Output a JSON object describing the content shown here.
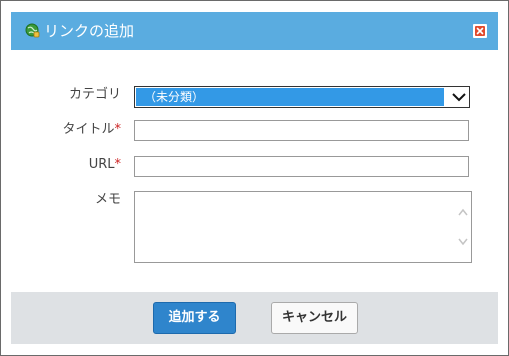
{
  "dialog": {
    "title": "リンクの追加",
    "title_icon": "globe-link-icon",
    "close_icon": "close-icon"
  },
  "form": {
    "category": {
      "label": "カテゴリ",
      "selected": "（未分類）"
    },
    "title": {
      "label": "タイトル",
      "required_mark": "*",
      "value": ""
    },
    "url": {
      "label": "URL",
      "required_mark": "*",
      "value": ""
    },
    "memo": {
      "label": "メモ",
      "value": ""
    }
  },
  "buttons": {
    "add": "追加する",
    "cancel": "キャンセル"
  },
  "colors": {
    "title_bar": "#5aace0",
    "primary_button": "#2f85cc",
    "required": "#cc2222",
    "selection": "#3399e6",
    "close": "#e24b2e",
    "footer": "#dee1e4"
  }
}
